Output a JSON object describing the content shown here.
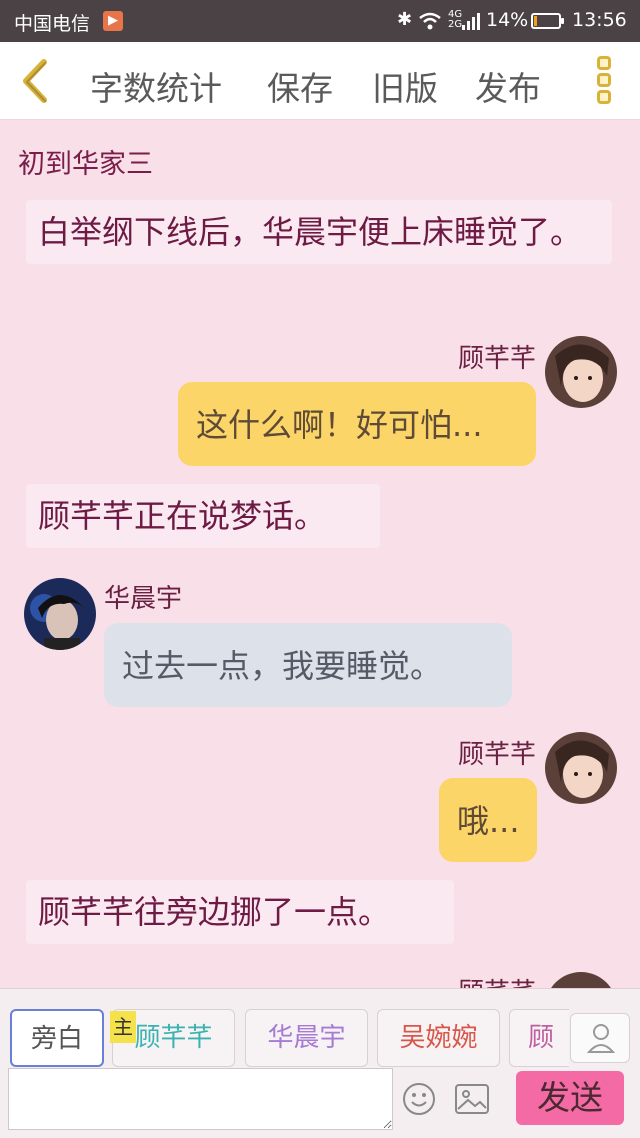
{
  "status_bar": {
    "carrier": "中国电信",
    "battery_percent": "14%",
    "battery_level": 0.14,
    "time": "13:56"
  },
  "toolbar": {
    "word_count": "字数统计",
    "save": "保存",
    "old_version": "旧版",
    "publish": "发布"
  },
  "chat": {
    "chapter_title": "初到华家三",
    "messages": [
      {
        "type": "narration",
        "text": "白举纲下线后，华晨宇便上床睡觉了。"
      },
      {
        "type": "right",
        "name": "顾芊芊",
        "text": "这什么啊！好可怕..."
      },
      {
        "type": "narration",
        "text": "顾芊芊正在说梦话。"
      },
      {
        "type": "left",
        "name": "华晨宇",
        "text": "过去一点，我要睡觉。"
      },
      {
        "type": "right",
        "name": "顾芊芊",
        "text": "哦..."
      },
      {
        "type": "narration",
        "text": "顾芊芊往旁边挪了一点。"
      }
    ]
  },
  "bottom": {
    "characters": [
      {
        "label": "旁白",
        "color": "#555555"
      },
      {
        "label": "顾芊芊",
        "color": "#3ab3b0"
      },
      {
        "label": "华晨宇",
        "color": "#a67bd4"
      },
      {
        "label": "吴婉婉",
        "color": "#d8574a"
      },
      {
        "label": "顾曦",
        "color": "#c05fa0"
      }
    ],
    "main_tag": "主",
    "input_placeholder": "",
    "send_label": "发送"
  },
  "colors": {
    "background": "#f8dfe8",
    "accent": "#f46aa5",
    "bubble_yellow": "#fbd567",
    "bubble_gray": "#dde1ea"
  }
}
